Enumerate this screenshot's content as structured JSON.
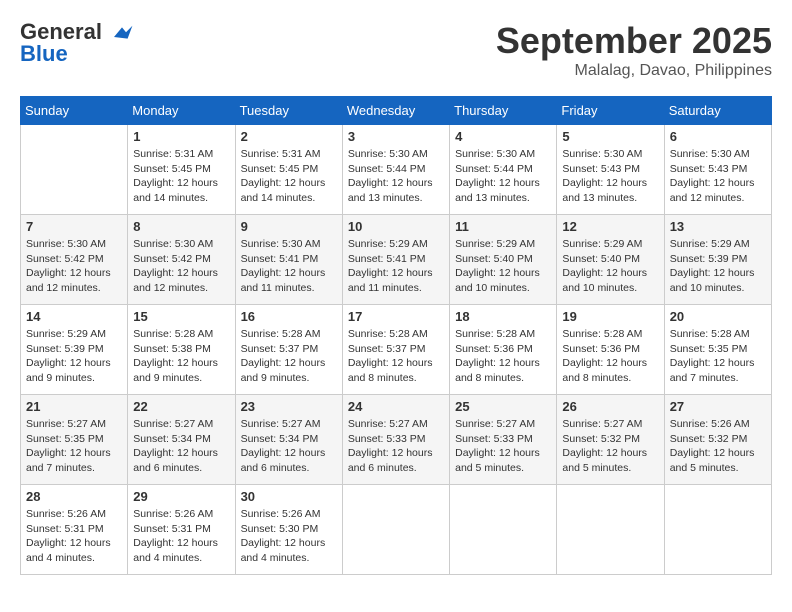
{
  "header": {
    "logo_line1": "General",
    "logo_line2": "Blue",
    "month": "September 2025",
    "location": "Malalag, Davao, Philippines"
  },
  "weekdays": [
    "Sunday",
    "Monday",
    "Tuesday",
    "Wednesday",
    "Thursday",
    "Friday",
    "Saturday"
  ],
  "weeks": [
    [
      {
        "day": "",
        "sunrise": "",
        "sunset": "",
        "daylight": ""
      },
      {
        "day": "1",
        "sunrise": "Sunrise: 5:31 AM",
        "sunset": "Sunset: 5:45 PM",
        "daylight": "Daylight: 12 hours and 14 minutes."
      },
      {
        "day": "2",
        "sunrise": "Sunrise: 5:31 AM",
        "sunset": "Sunset: 5:45 PM",
        "daylight": "Daylight: 12 hours and 14 minutes."
      },
      {
        "day": "3",
        "sunrise": "Sunrise: 5:30 AM",
        "sunset": "Sunset: 5:44 PM",
        "daylight": "Daylight: 12 hours and 13 minutes."
      },
      {
        "day": "4",
        "sunrise": "Sunrise: 5:30 AM",
        "sunset": "Sunset: 5:44 PM",
        "daylight": "Daylight: 12 hours and 13 minutes."
      },
      {
        "day": "5",
        "sunrise": "Sunrise: 5:30 AM",
        "sunset": "Sunset: 5:43 PM",
        "daylight": "Daylight: 12 hours and 13 minutes."
      },
      {
        "day": "6",
        "sunrise": "Sunrise: 5:30 AM",
        "sunset": "Sunset: 5:43 PM",
        "daylight": "Daylight: 12 hours and 12 minutes."
      }
    ],
    [
      {
        "day": "7",
        "sunrise": "Sunrise: 5:30 AM",
        "sunset": "Sunset: 5:42 PM",
        "daylight": "Daylight: 12 hours and 12 minutes."
      },
      {
        "day": "8",
        "sunrise": "Sunrise: 5:30 AM",
        "sunset": "Sunset: 5:42 PM",
        "daylight": "Daylight: 12 hours and 12 minutes."
      },
      {
        "day": "9",
        "sunrise": "Sunrise: 5:30 AM",
        "sunset": "Sunset: 5:41 PM",
        "daylight": "Daylight: 12 hours and 11 minutes."
      },
      {
        "day": "10",
        "sunrise": "Sunrise: 5:29 AM",
        "sunset": "Sunset: 5:41 PM",
        "daylight": "Daylight: 12 hours and 11 minutes."
      },
      {
        "day": "11",
        "sunrise": "Sunrise: 5:29 AM",
        "sunset": "Sunset: 5:40 PM",
        "daylight": "Daylight: 12 hours and 10 minutes."
      },
      {
        "day": "12",
        "sunrise": "Sunrise: 5:29 AM",
        "sunset": "Sunset: 5:40 PM",
        "daylight": "Daylight: 12 hours and 10 minutes."
      },
      {
        "day": "13",
        "sunrise": "Sunrise: 5:29 AM",
        "sunset": "Sunset: 5:39 PM",
        "daylight": "Daylight: 12 hours and 10 minutes."
      }
    ],
    [
      {
        "day": "14",
        "sunrise": "Sunrise: 5:29 AM",
        "sunset": "Sunset: 5:39 PM",
        "daylight": "Daylight: 12 hours and 9 minutes."
      },
      {
        "day": "15",
        "sunrise": "Sunrise: 5:28 AM",
        "sunset": "Sunset: 5:38 PM",
        "daylight": "Daylight: 12 hours and 9 minutes."
      },
      {
        "day": "16",
        "sunrise": "Sunrise: 5:28 AM",
        "sunset": "Sunset: 5:37 PM",
        "daylight": "Daylight: 12 hours and 9 minutes."
      },
      {
        "day": "17",
        "sunrise": "Sunrise: 5:28 AM",
        "sunset": "Sunset: 5:37 PM",
        "daylight": "Daylight: 12 hours and 8 minutes."
      },
      {
        "day": "18",
        "sunrise": "Sunrise: 5:28 AM",
        "sunset": "Sunset: 5:36 PM",
        "daylight": "Daylight: 12 hours and 8 minutes."
      },
      {
        "day": "19",
        "sunrise": "Sunrise: 5:28 AM",
        "sunset": "Sunset: 5:36 PM",
        "daylight": "Daylight: 12 hours and 8 minutes."
      },
      {
        "day": "20",
        "sunrise": "Sunrise: 5:28 AM",
        "sunset": "Sunset: 5:35 PM",
        "daylight": "Daylight: 12 hours and 7 minutes."
      }
    ],
    [
      {
        "day": "21",
        "sunrise": "Sunrise: 5:27 AM",
        "sunset": "Sunset: 5:35 PM",
        "daylight": "Daylight: 12 hours and 7 minutes."
      },
      {
        "day": "22",
        "sunrise": "Sunrise: 5:27 AM",
        "sunset": "Sunset: 5:34 PM",
        "daylight": "Daylight: 12 hours and 6 minutes."
      },
      {
        "day": "23",
        "sunrise": "Sunrise: 5:27 AM",
        "sunset": "Sunset: 5:34 PM",
        "daylight": "Daylight: 12 hours and 6 minutes."
      },
      {
        "day": "24",
        "sunrise": "Sunrise: 5:27 AM",
        "sunset": "Sunset: 5:33 PM",
        "daylight": "Daylight: 12 hours and 6 minutes."
      },
      {
        "day": "25",
        "sunrise": "Sunrise: 5:27 AM",
        "sunset": "Sunset: 5:33 PM",
        "daylight": "Daylight: 12 hours and 5 minutes."
      },
      {
        "day": "26",
        "sunrise": "Sunrise: 5:27 AM",
        "sunset": "Sunset: 5:32 PM",
        "daylight": "Daylight: 12 hours and 5 minutes."
      },
      {
        "day": "27",
        "sunrise": "Sunrise: 5:26 AM",
        "sunset": "Sunset: 5:32 PM",
        "daylight": "Daylight: 12 hours and 5 minutes."
      }
    ],
    [
      {
        "day": "28",
        "sunrise": "Sunrise: 5:26 AM",
        "sunset": "Sunset: 5:31 PM",
        "daylight": "Daylight: 12 hours and 4 minutes."
      },
      {
        "day": "29",
        "sunrise": "Sunrise: 5:26 AM",
        "sunset": "Sunset: 5:31 PM",
        "daylight": "Daylight: 12 hours and 4 minutes."
      },
      {
        "day": "30",
        "sunrise": "Sunrise: 5:26 AM",
        "sunset": "Sunset: 5:30 PM",
        "daylight": "Daylight: 12 hours and 4 minutes."
      },
      {
        "day": "",
        "sunrise": "",
        "sunset": "",
        "daylight": ""
      },
      {
        "day": "",
        "sunrise": "",
        "sunset": "",
        "daylight": ""
      },
      {
        "day": "",
        "sunrise": "",
        "sunset": "",
        "daylight": ""
      },
      {
        "day": "",
        "sunrise": "",
        "sunset": "",
        "daylight": ""
      }
    ]
  ]
}
